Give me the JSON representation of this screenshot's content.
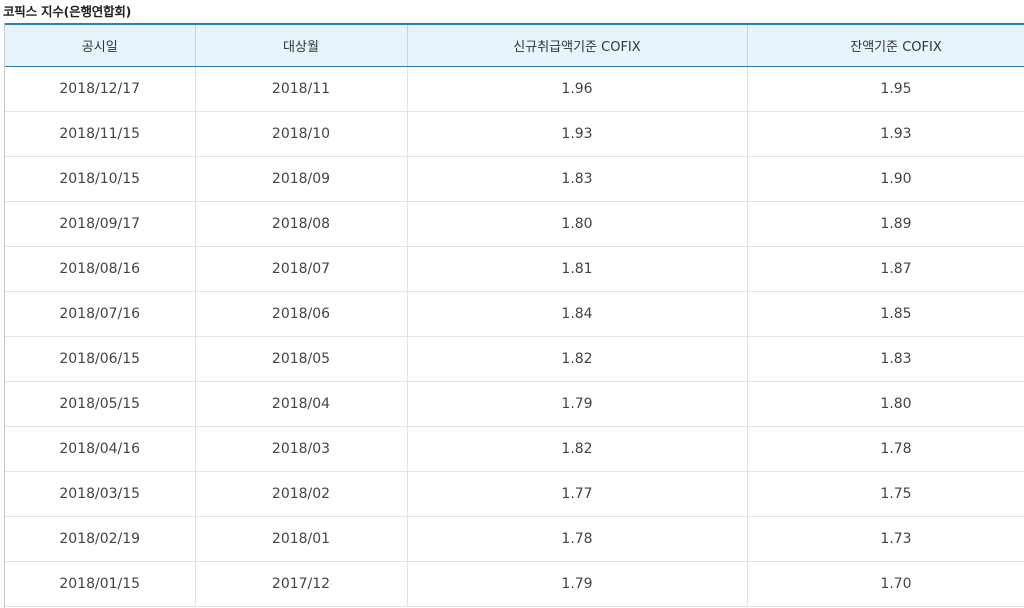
{
  "title": "코픽스 지수(은행연합회)",
  "table": {
    "headers": [
      "공시일",
      "대상월",
      "신규취급액기준 COFIX",
      "잔액기준 COFIX"
    ],
    "rows": [
      [
        "2018/12/17",
        "2018/11",
        "1.96",
        "1.95"
      ],
      [
        "2018/11/15",
        "2018/10",
        "1.93",
        "1.93"
      ],
      [
        "2018/10/15",
        "2018/09",
        "1.83",
        "1.90"
      ],
      [
        "2018/09/17",
        "2018/08",
        "1.80",
        "1.89"
      ],
      [
        "2018/08/16",
        "2018/07",
        "1.81",
        "1.87"
      ],
      [
        "2018/07/16",
        "2018/06",
        "1.84",
        "1.85"
      ],
      [
        "2018/06/15",
        "2018/05",
        "1.82",
        "1.83"
      ],
      [
        "2018/05/15",
        "2018/04",
        "1.79",
        "1.80"
      ],
      [
        "2018/04/16",
        "2018/03",
        "1.82",
        "1.78"
      ],
      [
        "2018/03/15",
        "2018/02",
        "1.77",
        "1.75"
      ],
      [
        "2018/02/19",
        "2018/01",
        "1.78",
        "1.73"
      ],
      [
        "2018/01/15",
        "2017/12",
        "1.79",
        "1.70"
      ]
    ]
  },
  "colors": {
    "header_bg": "#e7f4fc",
    "header_border": "#2d7fb8",
    "row_border": "#e3e3e3"
  }
}
